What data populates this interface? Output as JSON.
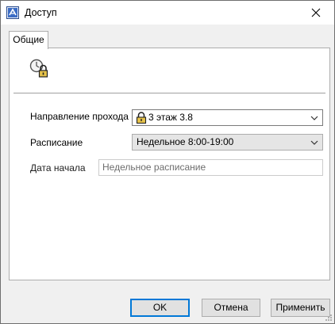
{
  "window": {
    "title": "Доступ",
    "app_icon": "app-icon",
    "close_icon": "close-icon"
  },
  "tabs": [
    {
      "label": "Общие",
      "active": true
    }
  ],
  "header": {
    "icon": "access-lock-icon"
  },
  "fields": {
    "direction": {
      "label": "Направление прохода",
      "value": "3 этаж 3.8",
      "icon": "lock-icon"
    },
    "schedule": {
      "label": "Расписание",
      "value": "Недельное 8:00-19:00"
    },
    "start_date": {
      "label": "Дата начала",
      "placeholder": "Недельное расписание"
    }
  },
  "buttons": {
    "ok": "OK",
    "cancel": "Отмена",
    "apply": "Применить"
  },
  "colors": {
    "accent": "#0078d7",
    "dialog_bg": "#f0f0f0",
    "panel_bg": "#ffffff"
  }
}
